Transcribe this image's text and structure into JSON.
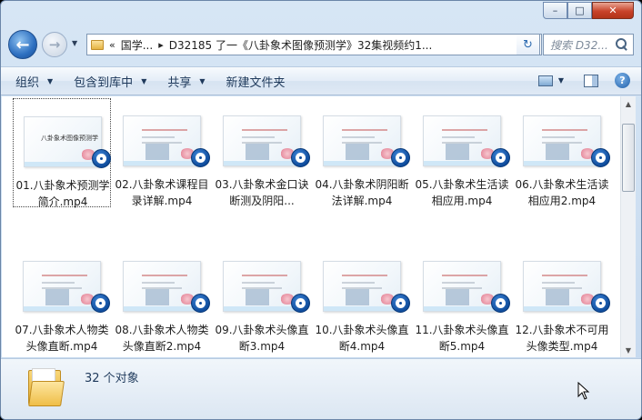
{
  "window": {
    "caption_buttons": {
      "minimize": "–",
      "maximize": "□",
      "close": "✕"
    }
  },
  "nav": {
    "back_icon": "back-arrow-icon",
    "forward_icon": "forward-arrow-icon",
    "address": {
      "overflow": "«",
      "crumbs": [
        "国学...",
        "D32185 了一《八卦象术图像预测学》32集视频约1..."
      ],
      "separator": "▸"
    },
    "search_placeholder": "搜索 D32..."
  },
  "toolbar": {
    "organize": "组织",
    "include_in_library": "包含到库中",
    "share": "共享",
    "new_folder": "新建文件夹"
  },
  "files": [
    {
      "name": "01.八卦象术预测学简介.mp4",
      "thumb_title": "八卦象术图像预测学"
    },
    {
      "name": "02.八卦象术课程目录详解.mp4"
    },
    {
      "name": "03.八卦象术金口诀断测及阴阳..."
    },
    {
      "name": "04.八卦象术阴阳断法详解.mp4"
    },
    {
      "name": "05.八卦象术生活读相应用.mp4"
    },
    {
      "name": "06.八卦象术生活读相应用2.mp4"
    },
    {
      "name": "07.八卦象术人物类头像直断.mp4"
    },
    {
      "name": "08.八卦象术人物类头像直断2.mp4"
    },
    {
      "name": "09.八卦象术头像直断3.mp4"
    },
    {
      "name": "10.八卦象术头像直断4.mp4"
    },
    {
      "name": "11.八卦象术头像直断5.mp4"
    },
    {
      "name": "12.八卦象术不可用头像类型.mp4"
    }
  ],
  "status": {
    "count_text": "32 个对象"
  },
  "colors": {
    "chrome": "#c4d8ee",
    "command_text": "#1e395b",
    "media_badge": "#0f4c9c",
    "close_button": "#c8432a"
  }
}
